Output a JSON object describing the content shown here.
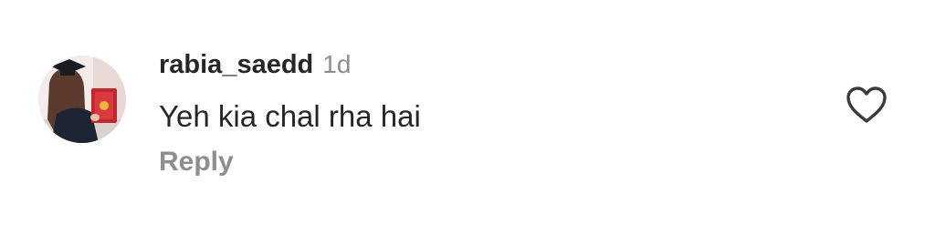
{
  "comment": {
    "username": "rabia_saedd",
    "time": "1d",
    "text": "Yeh kia chal rha hai",
    "reply_label": "Reply",
    "avatar_icon": "graduate-photo-avatar",
    "like_icon": "heart-outline-icon"
  },
  "colors": {
    "username": "#262626",
    "meta": "#8e8e8e",
    "icon": "#3a3a3a"
  }
}
